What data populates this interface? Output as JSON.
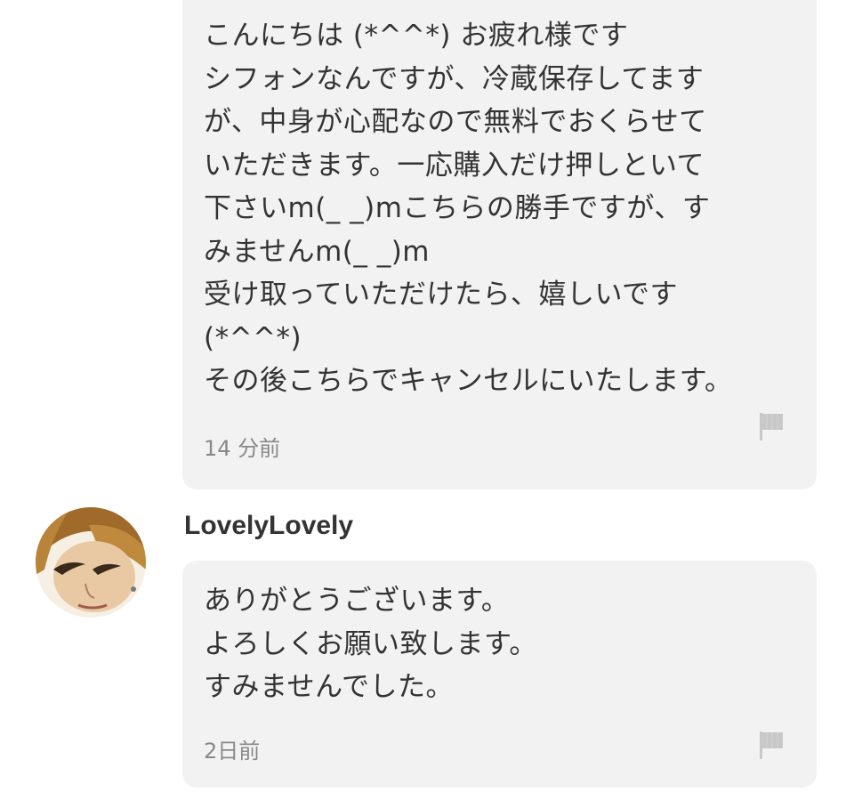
{
  "messages": [
    {
      "lines": [
        "こんにちは (*^^*) お疲れ様です",
        "シフォンなんですが、冷蔵保存してます",
        "が、中身が心配なので無料でおくらせて",
        "いただきます。一応購入だけ押しといて",
        "下さいm(_ _)mこちらの勝手ですが、す",
        "みませんm(_ _)m",
        "受け取っていただけたら、嬉しいです",
        "(*^^*)",
        "その後こちらでキャンセルにいたします。"
      ],
      "timestamp": "14 分前",
      "flag_icon": "flag-icon"
    },
    {
      "username": "LovelyLovely",
      "lines": [
        "ありがとうございます。",
        "よろしくお願い致します。",
        "すみませんでした。"
      ],
      "timestamp": "2日前",
      "flag_icon": "flag-icon"
    }
  ],
  "colors": {
    "bubble_background": "#f2f2f2",
    "text": "#333333",
    "timestamp": "#888888",
    "flag": "#c8c8c8"
  }
}
